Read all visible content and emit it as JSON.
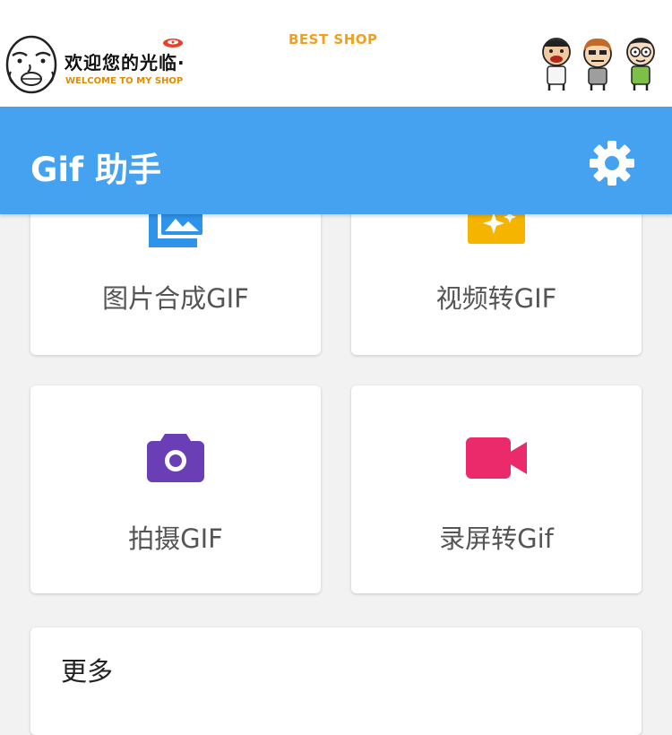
{
  "banner": {
    "welcome_cn": "欢迎您的光临·",
    "welcome_en": "WELCOME TO MY SHOP",
    "shop_name": "BEST SHOP"
  },
  "appbar": {
    "title": "Gif 助手",
    "settings_icon": "gear-icon"
  },
  "features": [
    {
      "label": "图片合成GIF",
      "icon": "image-gallery-icon",
      "color": "#2f93ea"
    },
    {
      "label": "视频转GIF",
      "icon": "sparkle-video-icon",
      "color": "#f4b400"
    },
    {
      "label": "拍摄GIF",
      "icon": "camera-icon",
      "color": "#6a3fb6"
    },
    {
      "label": "录屏转Gif",
      "icon": "videocam-icon",
      "color": "#ea2a6a"
    }
  ],
  "more": {
    "label": "更多"
  },
  "colors": {
    "appbar": "#45a2f0",
    "background": "#f2f2f2",
    "card": "#ffffff"
  }
}
